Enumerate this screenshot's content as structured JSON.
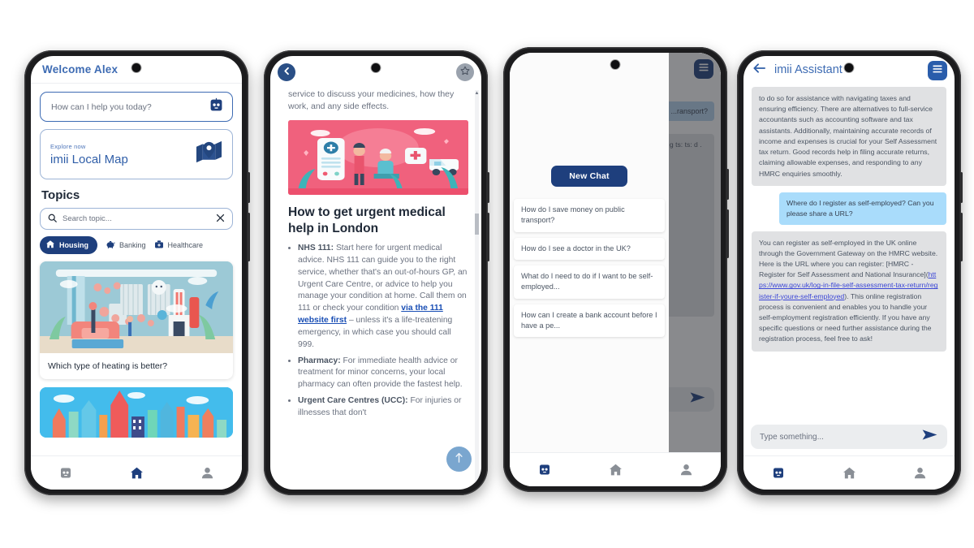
{
  "phone1": {
    "header_title": "Welcome Alex",
    "ask_placeholder": "How can I help you today?",
    "ask_icon": "bot-icon",
    "map_card": {
      "eyebrow": "Explore now",
      "title": "imii Local Map",
      "icon": "map-pin-icon"
    },
    "topics_heading": "Topics",
    "search_placeholder": "Search topic...",
    "search_icon": "search-icon",
    "clear_icon": "close-icon",
    "chips": [
      {
        "label": "Housing",
        "icon": "home-icon",
        "active": true
      },
      {
        "label": "Banking",
        "icon": "piggy-bank-icon",
        "active": false
      },
      {
        "label": "Healthcare",
        "icon": "medical-bag-icon",
        "active": false
      }
    ],
    "cards": [
      {
        "caption": "Which type of heating is better?",
        "image": "heating-room-illustration"
      },
      {
        "caption": "",
        "image": "city-skyline-illustration"
      }
    ],
    "nav": [
      {
        "name": "bot-icon",
        "active": false
      },
      {
        "name": "home-icon",
        "active": true
      },
      {
        "name": "profile-icon",
        "active": false
      }
    ]
  },
  "phone2": {
    "back_icon": "chevron-left-icon",
    "favourite_icon": "star-icon",
    "lead_text": "service to discuss your medicines, how they work, and any side effects.",
    "hero_image": "pharmacy-illustration",
    "article_title": "How to get urgent medical help in London",
    "bullets": [
      {
        "term": "NHS 111:",
        "before": " Start here for urgent medical advice. NHS 111 can guide you to the right service, whether that's an out-of-hours GP, an Urgent Care Centre, or advice to help you manage your condition at home. Call them on 111 or check your condition ",
        "link": "via the 111 website first",
        "after": " – unless it's a life-treatening emergency, in which case you should call 999."
      },
      {
        "term": "Pharmacy:",
        "before": " For immediate health advice or treatment for minor concerns, your local pharmacy can often provide the fastest help.",
        "link": "",
        "after": ""
      },
      {
        "term": "Urgent Care Centres (UCC):",
        "before": " For injuries or illnesses that don't",
        "link": "",
        "after": ""
      }
    ],
    "scroll_top_icon": "arrow-up-icon",
    "scrollbar_arrow_icon": "caret-up-icon"
  },
  "phone3": {
    "menu_icon": "hamburger-menu-icon",
    "new_chat_label": "New Chat",
    "history": [
      "How do I save money on public transport?",
      "How do I see a doctor in the UK?",
      "What do I need to do if I want to be self-employed...",
      "How can I create a bank account before I have a pe..."
    ],
    "background_user_message": "...ransport?",
    "background_bot_message": "can ... s. gle or se bot. g ts: ts: d .",
    "send_icon": "send-icon",
    "nav": [
      {
        "name": "bot-icon",
        "active": true
      },
      {
        "name": "home-icon",
        "active": false
      },
      {
        "name": "profile-icon",
        "active": false
      }
    ]
  },
  "phone4": {
    "back_icon": "arrow-left-icon",
    "title": "imii Assistant",
    "menu_icon": "hamburger-menu-icon",
    "messages": [
      {
        "role": "assistant",
        "text": "to do so for assistance with navigating taxes and ensuring efficiency. There are alternatives to full-service accountants such as accounting software and tax assistants. Additionally, maintaining accurate records of income and expenses is crucial for your Self Assessment tax return. Good records help in filing accurate returns, claiming allowable expenses, and responding to any HMRC enquiries smoothly."
      },
      {
        "role": "user",
        "text": "Where do I register as self-employed? Can you please share a URL?"
      },
      {
        "role": "assistant",
        "text_before": "You can register as self-employed in the UK online through the Government Gateway on the HMRC website. Here is the URL where you can register: [HMRC - Register for Self Assessment and National Insurance](",
        "link": "https://www.gov.uk/log-in-file-self-assessment-tax-return/register-if-youre-self-employed",
        "text_after": "). This online registration process is convenient and enables you to handle your self-employment registration efficiently. If you have any specific questions or need further assistance during the registration process, feel free to ask!"
      }
    ],
    "input_placeholder": "Type something...",
    "send_icon": "send-icon",
    "nav": [
      {
        "name": "bot-icon",
        "active": true
      },
      {
        "name": "home-icon",
        "active": false
      },
      {
        "name": "profile-icon",
        "active": false
      }
    ]
  },
  "colors": {
    "brand_navy": "#1e3f7d",
    "brand_blue": "#3d6bb3",
    "link_blue": "#1a4fb5",
    "user_bubble": "#a9dcfb",
    "bot_bubble": "#e0e1e3",
    "page_bg": "#ffffff"
  }
}
